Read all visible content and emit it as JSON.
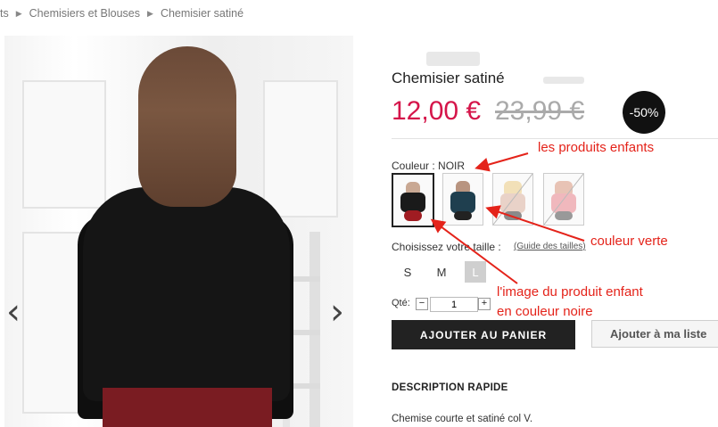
{
  "breadcrumb": {
    "items": [
      "ts",
      "Chemisiers et Blouses",
      "Chemisier satiné"
    ]
  },
  "product": {
    "title": "Chemisier satiné",
    "price_new": "12,00 €",
    "price_old": "23,99 €",
    "discount_badge": "-50%",
    "color_label": "Couleur : NOIR",
    "swatches": [
      {
        "name": "noir",
        "color": "#1a1a1a",
        "selected": true
      },
      {
        "name": "vert",
        "color": "#1f3f4f",
        "selected": false
      },
      {
        "name": "rose-pale",
        "color": "#e9d2c8",
        "selected": false
      },
      {
        "name": "rose",
        "color": "#f0b8bd",
        "selected": false
      }
    ],
    "size_label": "Choisissez votre taille :",
    "size_guide": "(Guide des tailles)",
    "sizes": [
      "S",
      "M",
      "L"
    ],
    "qty_label": "Qté:",
    "qty_value": "1",
    "qty_minus": "−",
    "qty_plus": "+",
    "add_to_cart": "AJOUTER AU PANIER",
    "wishlist": "Ajouter à ma liste",
    "desc_title": "DESCRIPTION RAPIDE",
    "desc_text": "Chemise courte et satiné col V."
  },
  "annotations": {
    "children": "les produits enfants",
    "green": "couleur verte",
    "image_line1": "l'image du produit enfant",
    "image_line2": "en couleur noire",
    "color": "#e4231a"
  },
  "gallery": {
    "prev_icon": "‹",
    "next_icon": "›"
  }
}
